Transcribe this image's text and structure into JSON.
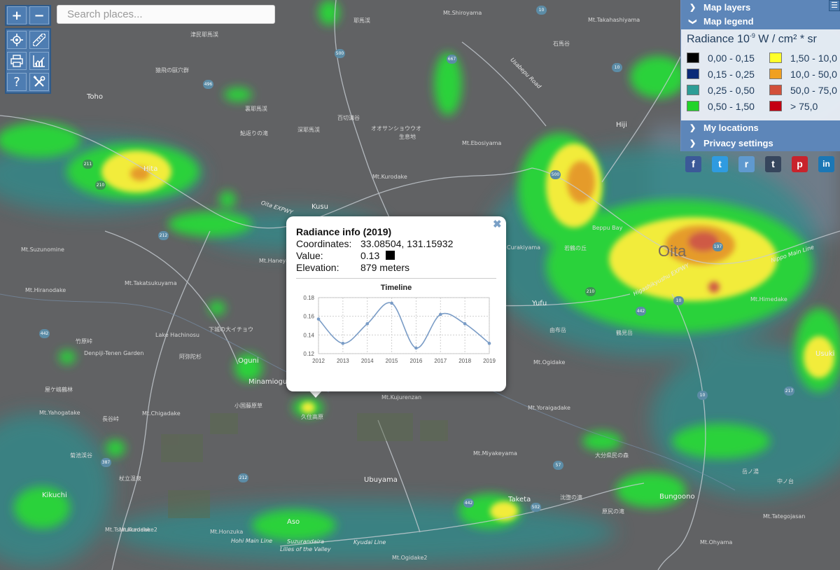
{
  "search": {
    "placeholder": "Search places..."
  },
  "controls": {
    "zoom_in_label": "+",
    "zoom_out_label": "−",
    "help_label": "?",
    "icons": [
      "location-icon",
      "ruler-icon",
      "print-icon",
      "chart-icon",
      "help-icon",
      "tools-icon"
    ]
  },
  "panel": {
    "map_layers_label": "Map layers",
    "map_legend_label": "Map legend",
    "legend_title_prefix": "Radiance 10",
    "legend_title_exp": "-9",
    "legend_title_suffix": " W / cm² * sr",
    "legend_items": [
      {
        "label": "0,00 - 0,15",
        "color": "#000000"
      },
      {
        "label": "0,15 - 0,25",
        "color": "#0b2a78"
      },
      {
        "label": "0,25 - 0,50",
        "color": "#2d9d96"
      },
      {
        "label": "0,50 - 1,50",
        "color": "#22d32a"
      },
      {
        "label": "1,50 - 10,0",
        "color": "#ffff2a"
      },
      {
        "label": "10,0 - 50,0",
        "color": "#f0a020"
      },
      {
        "label": "50,0 - 75,0",
        "color": "#d2503a"
      },
      {
        "label": "> 75,0",
        "color": "#c40012"
      }
    ],
    "my_locations_label": "My locations",
    "privacy_settings_label": "Privacy settings"
  },
  "social": [
    {
      "name": "facebook-icon",
      "glyph": "f",
      "color": "#3b5998"
    },
    {
      "name": "twitter-icon",
      "glyph": "t",
      "color": "#2f9be0"
    },
    {
      "name": "reddit-icon",
      "glyph": "r",
      "color": "#5f99cf"
    },
    {
      "name": "tumblr-icon",
      "glyph": "t",
      "color": "#36465d"
    },
    {
      "name": "pinterest-icon",
      "glyph": "p",
      "color": "#c8232c"
    },
    {
      "name": "linkedin-icon",
      "glyph": "in",
      "color": "#1b77b5"
    }
  ],
  "popup": {
    "title": "Radiance info (2019)",
    "coordinates_label": "Coordinates:",
    "coordinates_value": "33.08504, 131.15932",
    "value_label": "Value:",
    "value_value": "0.13",
    "value_color": "#000000",
    "elevation_label": "Elevation:",
    "elevation_value": "879 meters"
  },
  "chart_data": {
    "type": "line",
    "title": "Timeline",
    "x": [
      "2012",
      "2013",
      "2014",
      "2015",
      "2016",
      "2017",
      "2018",
      "2019"
    ],
    "y": [
      0.157,
      0.131,
      0.152,
      0.174,
      0.126,
      0.162,
      0.152,
      0.131
    ],
    "yticks": [
      "0.18",
      "0.16",
      "0.14",
      "0.12"
    ],
    "ylim": [
      0.12,
      0.18
    ],
    "grid": true,
    "line_color": "#7a9cc6"
  },
  "map_labels": [
    "Oita",
    "Hita",
    "Kusu",
    "Yufu",
    "Usuki",
    "Ubuyama",
    "Taketa",
    "Bungoono",
    "Kikuchi",
    "Aso",
    "Toho",
    "Hiji",
    "Minamioguni",
    "Oguni",
    "Oita EXPWY",
    "Higashikyushu EXPWY",
    "Usabepu Road",
    "Nippo Main Line",
    "Hohi Main Line",
    "Kyudai Line",
    "Lake Hachinosu",
    "Mt.Kurodake",
    "Mt.Suzunomine",
    "Mt.Hiranodake",
    "Mt.Takatsukuyama",
    "Mt.Haneyama",
    "Mt.Kujurenzan",
    "Mt.Yoraigadake",
    "Mt.Miyakeyama",
    "Mt.Chigadake",
    "Mt.Yahogatake",
    "Mt.Ebosiyama",
    "Mt.Takahashiyama",
    "Mt.Tsuruikedake",
    "Mt.Ohyama",
    "Mt.Tategojasan",
    "Mt.Shiroyama",
    "Mt.Ogidake",
    "Mt.Honzuka",
    "Mt.Kurodake2",
    "Mt.Ogidake2",
    "Mt.Himedake",
    "Curakiyama",
    "Beppu Bay",
    "Lilies of the Valley",
    "Suzurandaira",
    "Denpiji-Tenen Garden",
    "耶馬渓",
    "津民耶馬渓",
    "深耶馬渓",
    "裏耶馬渓",
    "百切溝谷",
    "オオサンショウウオ",
    "生息地",
    "石馬谷",
    "菊池渓谷",
    "下城の大イチョウ",
    "阿弥陀杉",
    "杖立温泉",
    "竹原峠",
    "岳ノ湯",
    "屋ケ嶋鶴林",
    "長谷峠",
    "小国藤原草",
    "猿飛の甌穴群",
    "鮎返りの滝",
    "中ノ台",
    "大分県民の森",
    "由布岳",
    "鶴見岳",
    "久住高原",
    "沈堕の滝",
    "原尻の滝",
    "若鶴の丘"
  ]
}
